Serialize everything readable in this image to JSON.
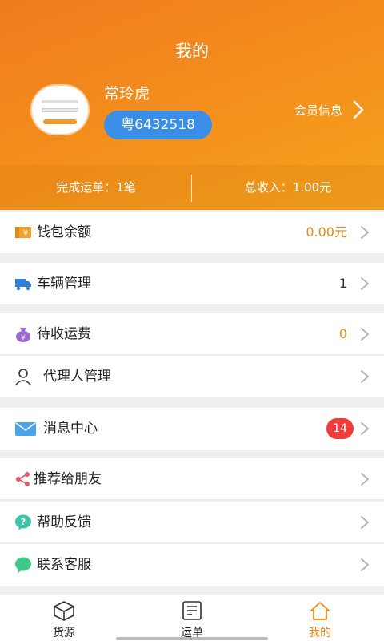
{
  "header": {
    "title": "我的",
    "username": "常玲虎",
    "plate": "粤6432518",
    "member_info": "会员信息"
  },
  "stats": {
    "completed": "完成运单：1笔",
    "income": "总收入：1.00元"
  },
  "menu": {
    "wallet": {
      "label": "钱包余额",
      "value": "0.00元"
    },
    "vehicles": {
      "label": "车辆管理",
      "value": "1"
    },
    "pending_fee": {
      "label": "待收运费",
      "value": "0"
    },
    "agent": {
      "label": "代理人管理"
    },
    "messages": {
      "label": "消息中心",
      "badge": "14"
    },
    "share": {
      "label": "推荐给朋友"
    },
    "help": {
      "label": "帮助反馈"
    },
    "service": {
      "label": "联系客服"
    }
  },
  "tabs": {
    "cargo": "货源",
    "orders": "运单",
    "mine": "我的"
  },
  "colors": {
    "header_orange": "#f4901c",
    "value_orange": "#e88a14",
    "plate_blue": "#3a8ee8",
    "badge_red": "#ee3b3b"
  },
  "icons": [
    "wallet-ticket-icon",
    "truck-icon",
    "money-bag-icon",
    "person-icon",
    "mail-icon",
    "share-icon",
    "question-bubble-icon",
    "chat-bubble-icon",
    "box-icon",
    "receipt-icon",
    "home-icon"
  ]
}
